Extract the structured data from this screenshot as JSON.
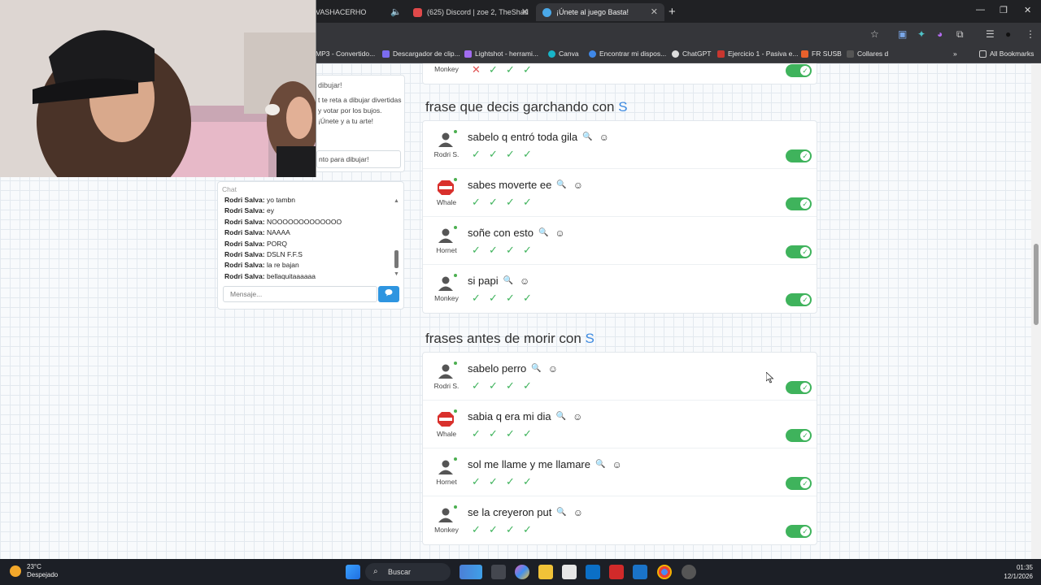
{
  "browser": {
    "tabs": [
      {
        "label": "VASHACERHO",
        "active": false
      },
      {
        "label": "(625) Discord | zoe 2, TheShad",
        "active": false
      },
      {
        "label": "¡Únete al juego Basta!",
        "active": true
      }
    ],
    "bookmarks": [
      "MP3 - Convertido...",
      "Descargador de clip...",
      "Lightshot - herrami...",
      "Canva",
      "Encontrar mi dispos...",
      "ChatGPT",
      "Ejercicio 1 - Pasiva e...",
      "FR SUSB",
      "Collares d",
      "All Bookmarks"
    ]
  },
  "side_panel": {
    "title": "dibujar!",
    "text": "t te reta a dibujar divertidas y votar por los bujos. ¡Únete y a tu arte!",
    "button": "nto para dibujar!"
  },
  "chat": {
    "title": "Chat",
    "lines": [
      {
        "user": "Rodri Salva:",
        "msg": "yo tambn"
      },
      {
        "user": "Rodri Salva:",
        "msg": "ey"
      },
      {
        "user": "Rodri Salva:",
        "msg": "NOOOOOOOOOOOOO"
      },
      {
        "user": "Rodri Salva:",
        "msg": "NAAAA"
      },
      {
        "user": "Rodri Salva:",
        "msg": "PORQ"
      },
      {
        "user": "Rodri Salva:",
        "msg": "DSLN F.F.S"
      },
      {
        "user": "Rodri Salva:",
        "msg": "la re bajan"
      },
      {
        "user": "Rodri Salva:",
        "msg": "bellaquitaaaaaa"
      }
    ],
    "input_placeholder": "Mensaje..."
  },
  "top_row": {
    "player": "Monkey"
  },
  "sections": [
    {
      "title": "frase que decis garchando con",
      "letter": "S",
      "answers": [
        {
          "player": "Rodri S.",
          "avatar": "person",
          "text": "sabelo q entró toda gila"
        },
        {
          "player": "Whale",
          "avatar": "stop",
          "text": "sabes moverte ee"
        },
        {
          "player": "Hornet",
          "avatar": "person",
          "text": "soñe con esto"
        },
        {
          "player": "Monkey",
          "avatar": "person",
          "text": "si papi"
        }
      ]
    },
    {
      "title": "frases antes de morir con",
      "letter": "S",
      "answers": [
        {
          "player": "Rodri S.",
          "avatar": "person",
          "text": "sabelo perro"
        },
        {
          "player": "Whale",
          "avatar": "stop",
          "text": "sabia q era mi dia"
        },
        {
          "player": "Hornet",
          "avatar": "person",
          "text": "sol me llame y me llamare"
        },
        {
          "player": "Monkey",
          "avatar": "person",
          "text": "se la creyeron put"
        }
      ]
    }
  ],
  "taskbar": {
    "temp": "23°C",
    "weather": "Despejado",
    "search": "Buscar",
    "time": "01:35",
    "date": "12/1/2026"
  },
  "colors": {
    "accent": "#3d8ae0",
    "check": "#3fb35c",
    "toggle": "#3fb35c"
  }
}
